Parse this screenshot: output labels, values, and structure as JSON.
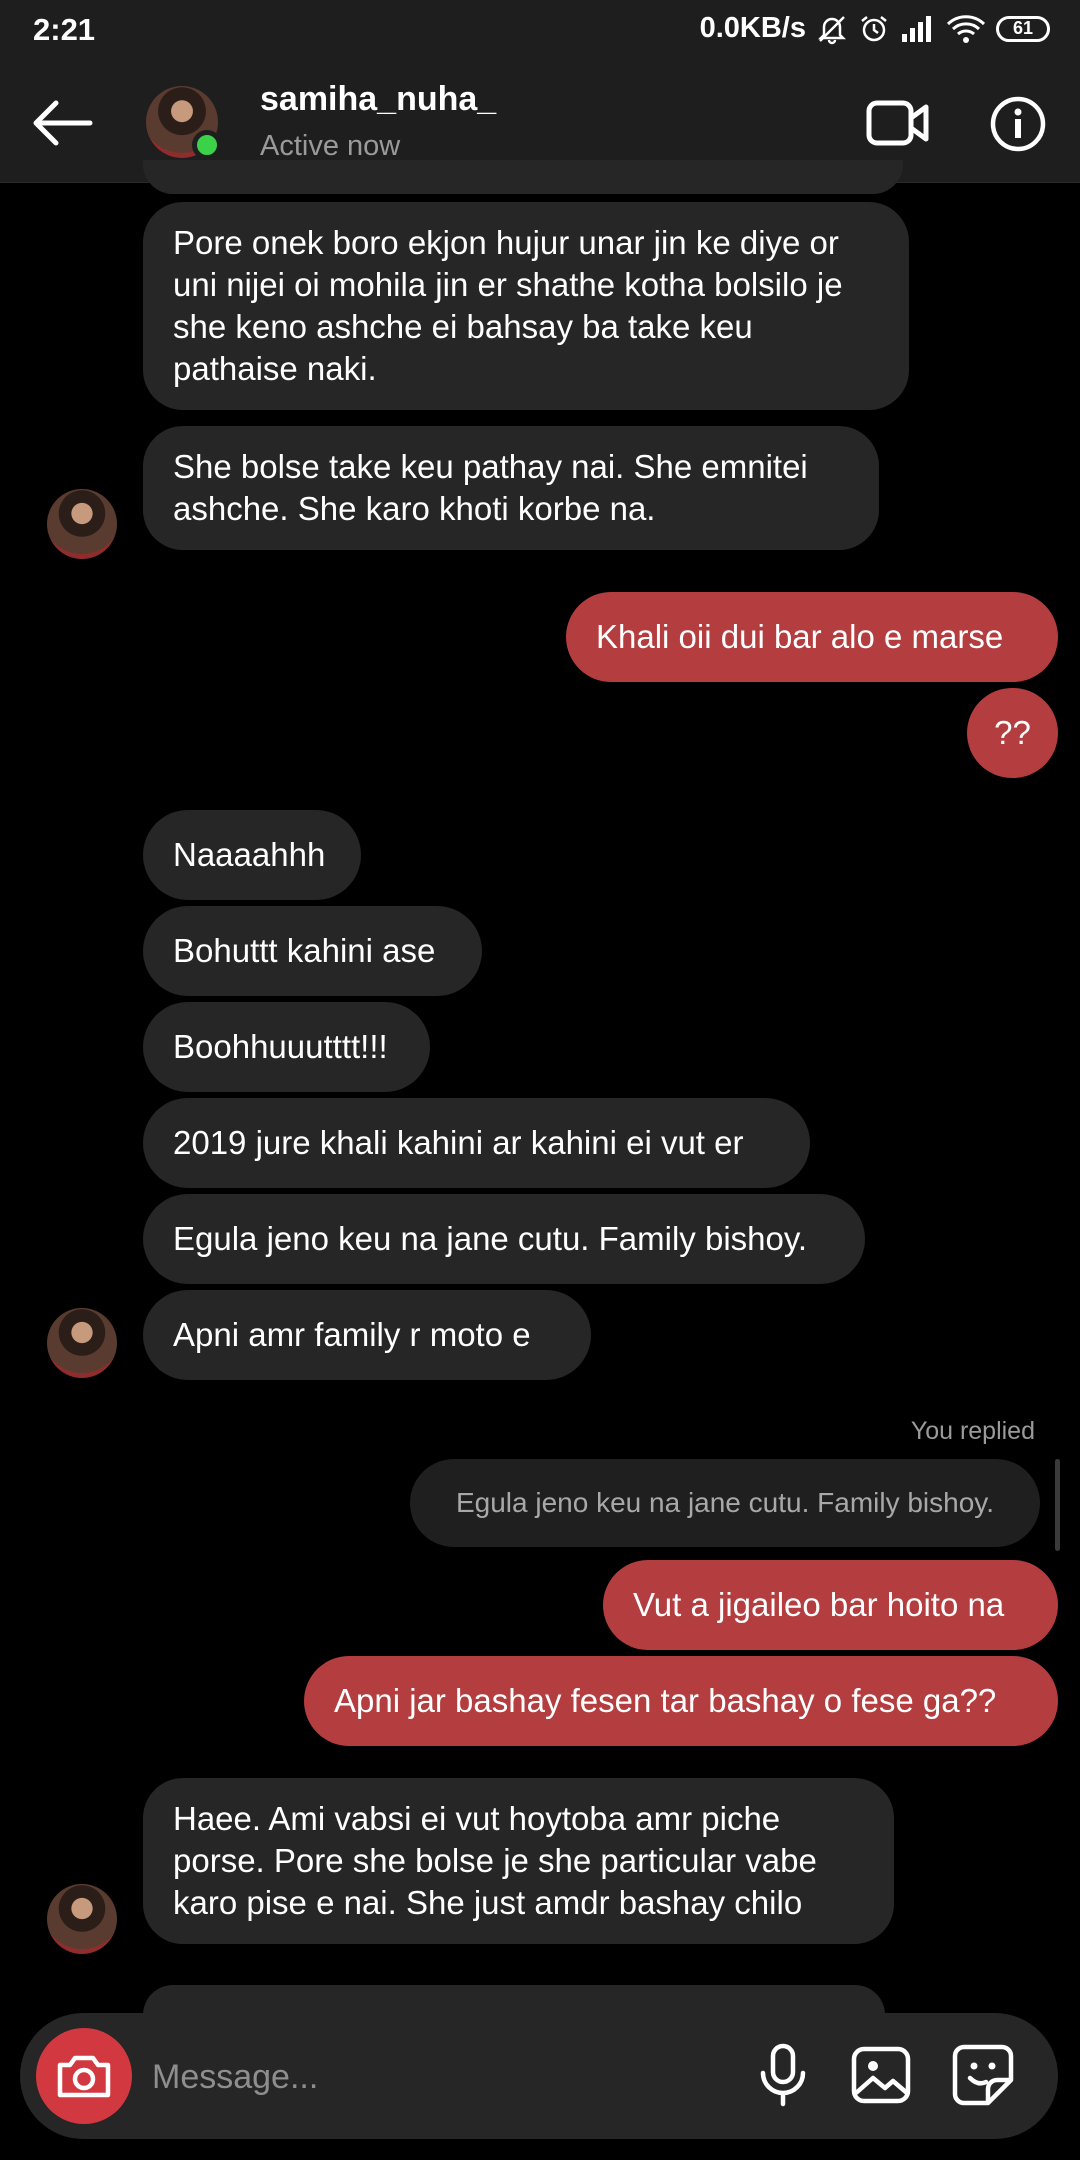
{
  "status_bar": {
    "time": "2:21",
    "network_speed": "0.0KB/s",
    "battery": "61",
    "icons": [
      "mute-icon",
      "alarm-icon",
      "signal-icon",
      "wifi-icon",
      "battery-icon"
    ]
  },
  "header": {
    "username": "samiha_nuha_",
    "status": "Active now"
  },
  "messages": [
    {
      "text": "Pore onek boro ekjon hujur unar jin ke diye or uni nijei oi mohila jin er shathe kotha bolsilo je she keno ashche ei bahsay ba take keu pathaise naki."
    },
    {
      "text": "She bolse take keu pathay nai. She emnitei ashche. She karo khoti korbe na."
    },
    {
      "text": "Khali oii dui bar alo e marse"
    },
    {
      "text": "??"
    },
    {
      "text": "Naaaahhh"
    },
    {
      "text": "Bohuttt kahini ase"
    },
    {
      "text": "Boohhuuutttt!!!"
    },
    {
      "text": "2019 jure khali kahini ar kahini ei vut er"
    },
    {
      "text": "Egula jeno keu na jane cutu. Family bishoy."
    },
    {
      "text": "Apni amr family r moto e"
    },
    {
      "text": "Vut a jigaileo bar hoito na"
    },
    {
      "text": "Apni jar bashay fesen tar bashay o fese ga??"
    },
    {
      "text": "Haee. Ami vabsi ei vut hoytoba amr piche porse. Pore she bolse je she particular vabe karo pise e nai. She just amdr bashay chilo"
    }
  ],
  "reply": {
    "label": "You replied",
    "quoted_text": "Egula jeno keu na jane cutu. Family bishoy."
  },
  "composer": {
    "placeholder": "Message..."
  },
  "colors": {
    "background": "#000000",
    "incoming_bubble": "#262626",
    "outgoing_bubble": "#b43d3f",
    "online": "#3bd24a",
    "camera_button": "#d2383f"
  }
}
